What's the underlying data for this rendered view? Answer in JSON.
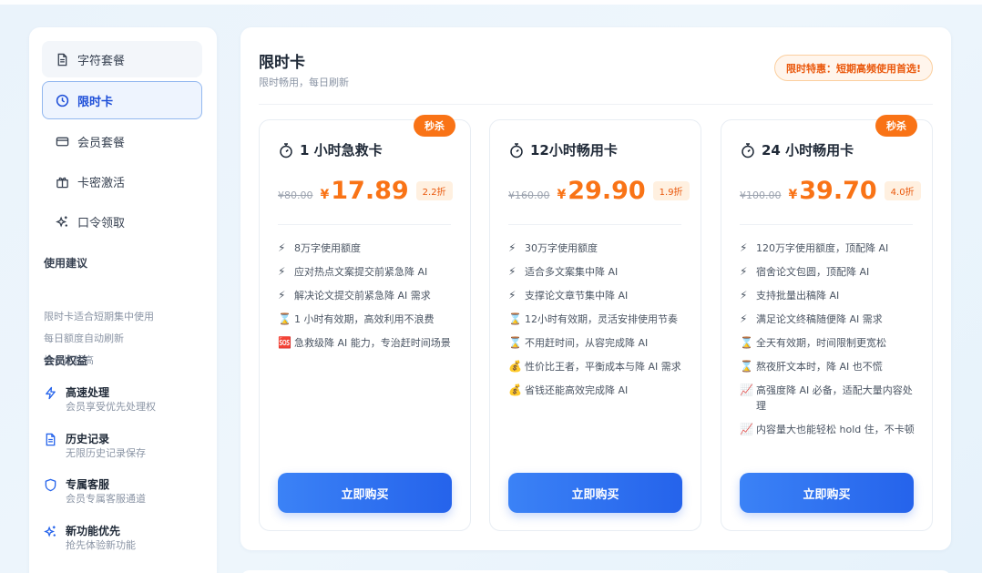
{
  "nav": [
    {
      "label": "字符套餐",
      "icon": "document-icon"
    },
    {
      "label": "限时卡",
      "icon": "clock-icon"
    },
    {
      "label": "会员套餐",
      "icon": "card-icon"
    },
    {
      "label": "卡密激活",
      "icon": "gift-icon"
    },
    {
      "label": "口令领取",
      "icon": "sparkle-icon"
    }
  ],
  "tips": {
    "title": "使用建议",
    "items": [
      "限时卡适合短期集中使用",
      "每日额度自动刷新",
      "性价比超高"
    ]
  },
  "benefits": {
    "title": "会员权益",
    "items": [
      {
        "title": "高速处理",
        "sub": "会员享受优先处理权",
        "icon": "lightning-icon"
      },
      {
        "title": "历史记录",
        "sub": "无限历史记录保存",
        "icon": "document-icon"
      },
      {
        "title": "专属客服",
        "sub": "会员专属客服通道",
        "icon": "shield-icon"
      },
      {
        "title": "新功能优先",
        "sub": "抢先体验新功能",
        "icon": "sparkle-icon"
      }
    ]
  },
  "main": {
    "title": "限时卡",
    "subtitle": "限时畅用，每日刷新",
    "promo": "限时特惠：短期高频使用首选!"
  },
  "colors": {
    "accent": "#2563eb",
    "price": "#f97316",
    "badge": "#f97316"
  },
  "cards": [
    {
      "badge": "秒杀",
      "title": "1 小时急救卡",
      "old_price": "¥80.00",
      "yen": "¥",
      "price": "17.89",
      "discount": "2.2折",
      "features": [
        {
          "icon": "⚡",
          "text": "8万字使用额度"
        },
        {
          "icon": "⚡",
          "text": "应对热点文案提交前紧急降 AI"
        },
        {
          "icon": "⚡",
          "text": "解决论文提交前紧急降 AI 需求"
        },
        {
          "icon": "⌛",
          "text": "1 小时有效期，高效利用不浪费"
        },
        {
          "icon": "🆘",
          "text": "急救级降 AI 能力，专治赶时间场景"
        }
      ],
      "button": "立即购买"
    },
    {
      "badge": "",
      "title": "12小时畅用卡",
      "old_price": "¥160.00",
      "yen": "¥",
      "price": "29.90",
      "discount": "1.9折",
      "features": [
        {
          "icon": "⚡",
          "text": "30万字使用额度"
        },
        {
          "icon": "⚡",
          "text": "适合多文案集中降 AI"
        },
        {
          "icon": "⚡",
          "text": "支撑论文章节集中降 AI"
        },
        {
          "icon": "⌛",
          "text": "12小时有效期，灵活安排使用节奏"
        },
        {
          "icon": "⌛",
          "text": "不用赶时间，从容完成降 AI"
        },
        {
          "icon": "💰",
          "text": "性价比王者，平衡成本与降 AI 需求"
        },
        {
          "icon": "💰",
          "text": "省钱还能高效完成降 AI"
        }
      ],
      "button": "立即购买"
    },
    {
      "badge": "秒杀",
      "title": "24 小时畅用卡",
      "old_price": "¥100.00",
      "yen": "¥",
      "price": "39.70",
      "discount": "4.0折",
      "features": [
        {
          "icon": "⚡",
          "text": "120万字使用额度，顶配降 AI"
        },
        {
          "icon": "⚡",
          "text": "宿舍论文包圆，顶配降 AI"
        },
        {
          "icon": "⚡",
          "text": "支持批量出稿降 AI"
        },
        {
          "icon": "⚡",
          "text": "满足论文终稿随便降 AI 需求"
        },
        {
          "icon": "⌛",
          "text": "全天有效期，时间限制更宽松"
        },
        {
          "icon": "⌛",
          "text": "熬夜肝文本时，降 AI 也不慌"
        },
        {
          "icon": "📈",
          "text": "高强度降 AI 必备，适配大量内容处理"
        },
        {
          "icon": "📈",
          "text": "内容量大也能轻松 hold 住，不卡顿"
        }
      ],
      "button": "立即购买"
    }
  ]
}
